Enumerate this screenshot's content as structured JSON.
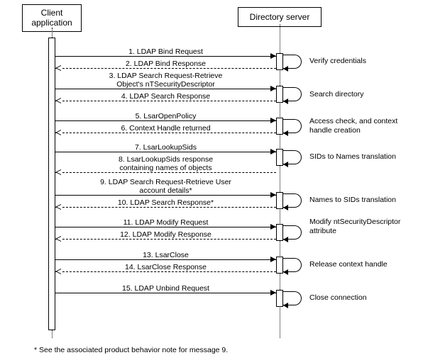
{
  "participants": {
    "client": "Client\napplication",
    "server": "Directory server"
  },
  "messages": {
    "m1": "1. LDAP Bind Request",
    "m2": "2. LDAP Bind Response",
    "m3": "3. LDAP Search Request-Retrieve\nObject's nTSecurityDescriptor",
    "m4": "4. LDAP Search Response",
    "m5": "5. LsarOpenPolicy",
    "m6": "6. Context Handle returned",
    "m7": "7. LsarLookupSids",
    "m8": "8. LsarLookupSids response\ncontaining names of objects",
    "m9": "9. LDAP Search Request-Retrieve User\naccount details*",
    "m10": "10. LDAP Search Response*",
    "m11": "11. LDAP Modify Request",
    "m12": "12. LDAP Modify Response",
    "m13": "13. LsarClose",
    "m14": "14. LsarClose Response",
    "m15": "15. LDAP Unbind Request"
  },
  "notes": {
    "n1": "Verify credentials",
    "n2": "Search directory",
    "n3": "Access check, and context\nhandle creation",
    "n4": "SIDs to Names translation",
    "n5": "Names to SIDs translation",
    "n6": "Modify\nntSecurityDescriptor\nattribute",
    "n7": "Release context handle",
    "n8": "Close connection"
  },
  "footnote": "* See the associated product behavior note for message 9."
}
